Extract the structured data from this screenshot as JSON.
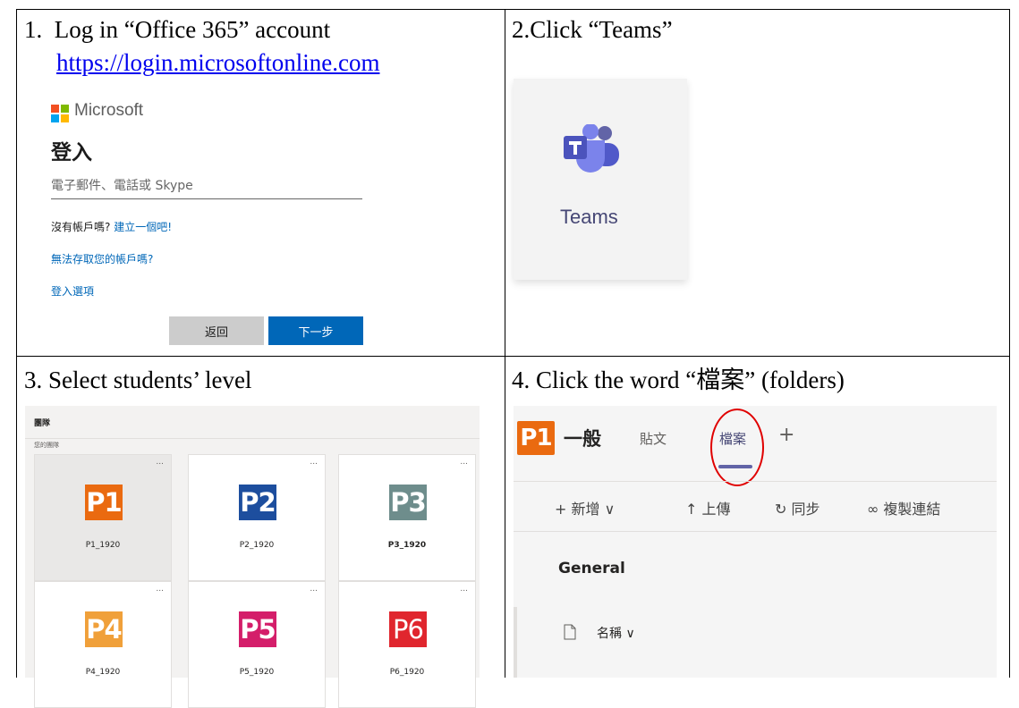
{
  "cell1": {
    "title": "1.  Log in “Office 365” account",
    "link": "https://login.microsoftonline.com",
    "ms_brand": "Microsoft",
    "signin_title": "登入",
    "email_placeholder": "電子郵件、電話或 Skype",
    "no_account": "沒有帳戶嗎?",
    "create_one": "建立一個吧!",
    "cant_access": "無法存取您的帳戶嗎?",
    "signin_options": "登入選項",
    "back_button": "返回",
    "next_button": "下一步",
    "logo_colors": [
      "#f25022",
      "#7fba00",
      "#00a4ef",
      "#ffb900"
    ]
  },
  "cell2": {
    "title": "2.Click “Teams”",
    "teams_label": "Teams",
    "icon": "teams-icon"
  },
  "cell3": {
    "title": "3. Select students’ level",
    "panel_title": "團隊",
    "panel_sub": "您的團隊",
    "teams": [
      {
        "logo": "P1",
        "name": "P1_1920",
        "color": "#ea6a10",
        "selected": true
      },
      {
        "logo": "P2",
        "name": "P2_1920",
        "color": "#1d4e9e",
        "selected": false
      },
      {
        "logo": "P3",
        "name": "P3_1920",
        "color": "#6e8d8c",
        "selected": false
      },
      {
        "logo": "P4",
        "name": "P4_1920",
        "color": "#f0a03a",
        "selected": false
      },
      {
        "logo": "P5",
        "name": "P5_1920",
        "color": "#d41e6a",
        "selected": false
      },
      {
        "logo": "P6",
        "name": "P6_1920",
        "color": "#e0262e",
        "selected": false
      }
    ],
    "more": "..."
  },
  "cell4": {
    "title": "4. Click the word “檔案” (folders)",
    "logo": "P1",
    "channel": "一般",
    "tab_posts": "貼文",
    "tab_files": "檔案",
    "tab_add": "+",
    "tool_new": "+ 新增 ∨",
    "tool_upload": "↑ 上傳",
    "tool_sync": "↻ 同步",
    "tool_copy": "∞ 複製連結",
    "section": "General",
    "name_header": "名稱 ∨"
  }
}
